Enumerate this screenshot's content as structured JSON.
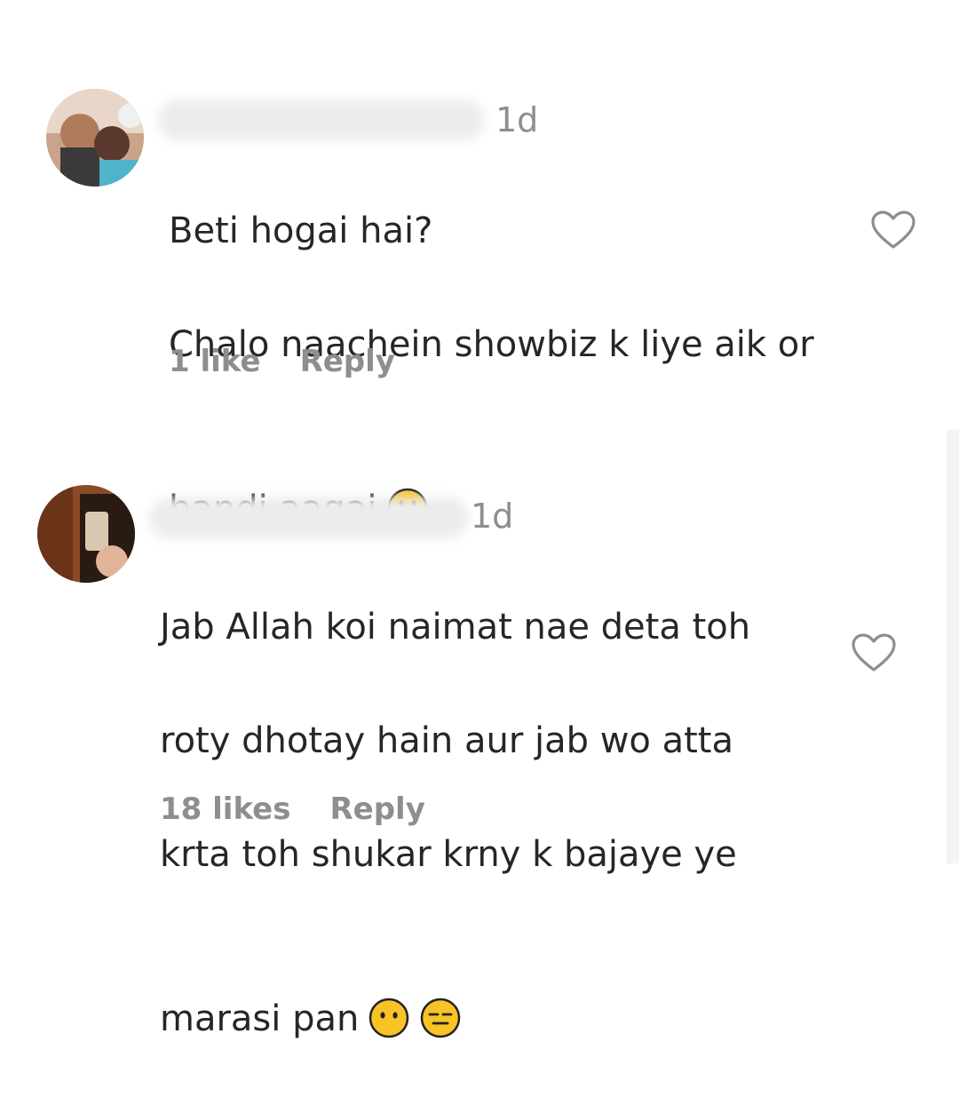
{
  "comments": [
    {
      "time": "1d",
      "text_line1": "Beti hogai hai?",
      "text_line2": "Chalo naachein showbiz k liye aik or",
      "text_line3": "bandi aagai",
      "emojis": [
        "slightly-smiling-face"
      ],
      "likes": "1 like",
      "reply": "Reply",
      "icons": {
        "like": "heart-outline-icon"
      }
    },
    {
      "time": "1d",
      "text_line1": "Jab Allah koi naimat nae deta toh",
      "text_line2": "roty dhotay hain aur jab wo atta",
      "text_line3": "krta toh shukar krny k bajaye ye",
      "text_line4": "marasi pan",
      "emojis": [
        "face-without-mouth",
        "expressionless-face"
      ],
      "likes": "18 likes",
      "reply": "Reply",
      "icons": {
        "like": "heart-outline-icon"
      }
    }
  ],
  "colors": {
    "text": "#262626",
    "muted": "#8e8e8e",
    "emoji": "#f7c325"
  }
}
